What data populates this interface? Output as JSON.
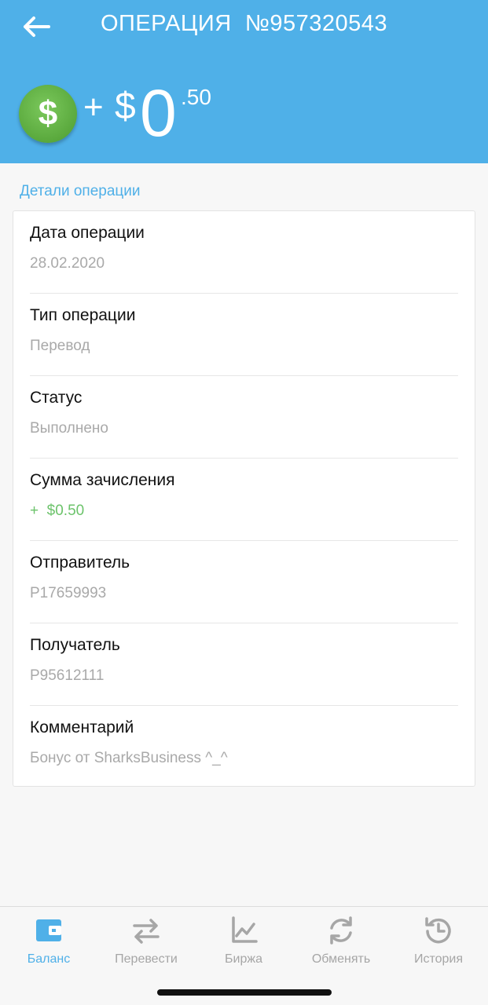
{
  "header": {
    "title_prefix": "ОПЕРАЦИЯ",
    "title_number": "№957320543",
    "back_icon": "arrow-left-icon",
    "coin_symbol": "$",
    "amount_sign": "+",
    "amount_currency": "$",
    "amount_main": "0",
    "amount_cents": ".50"
  },
  "details": {
    "section_label": "Детали операции",
    "rows": [
      {
        "label": "Дата операции",
        "value": "28.02.2020"
      },
      {
        "label": "Тип операции",
        "value": "Перевод"
      },
      {
        "label": "Статус",
        "value": "Выполнено"
      },
      {
        "label": "Сумма зачисления",
        "value": "+  $0.50"
      },
      {
        "label": "Отправитель",
        "value": "P17659993"
      },
      {
        "label": "Получатель",
        "value": "P95612111"
      },
      {
        "label": "Комментарий",
        "value": "Бонус от SharksBusiness ^_^"
      }
    ]
  },
  "tabbar": {
    "tabs": [
      {
        "label": "Баланс",
        "icon": "wallet-icon"
      },
      {
        "label": "Перевести",
        "icon": "transfer-arrows-icon"
      },
      {
        "label": "Биржа",
        "icon": "chart-icon"
      },
      {
        "label": "Обменять",
        "icon": "refresh-icon"
      },
      {
        "label": "История",
        "icon": "history-icon"
      }
    ],
    "active_index": 0
  },
  "colors": {
    "header_bg": "#4fb0e8",
    "accent": "#4fb0e8",
    "positive": "#6cc36b",
    "coin": "#5aa93d"
  }
}
